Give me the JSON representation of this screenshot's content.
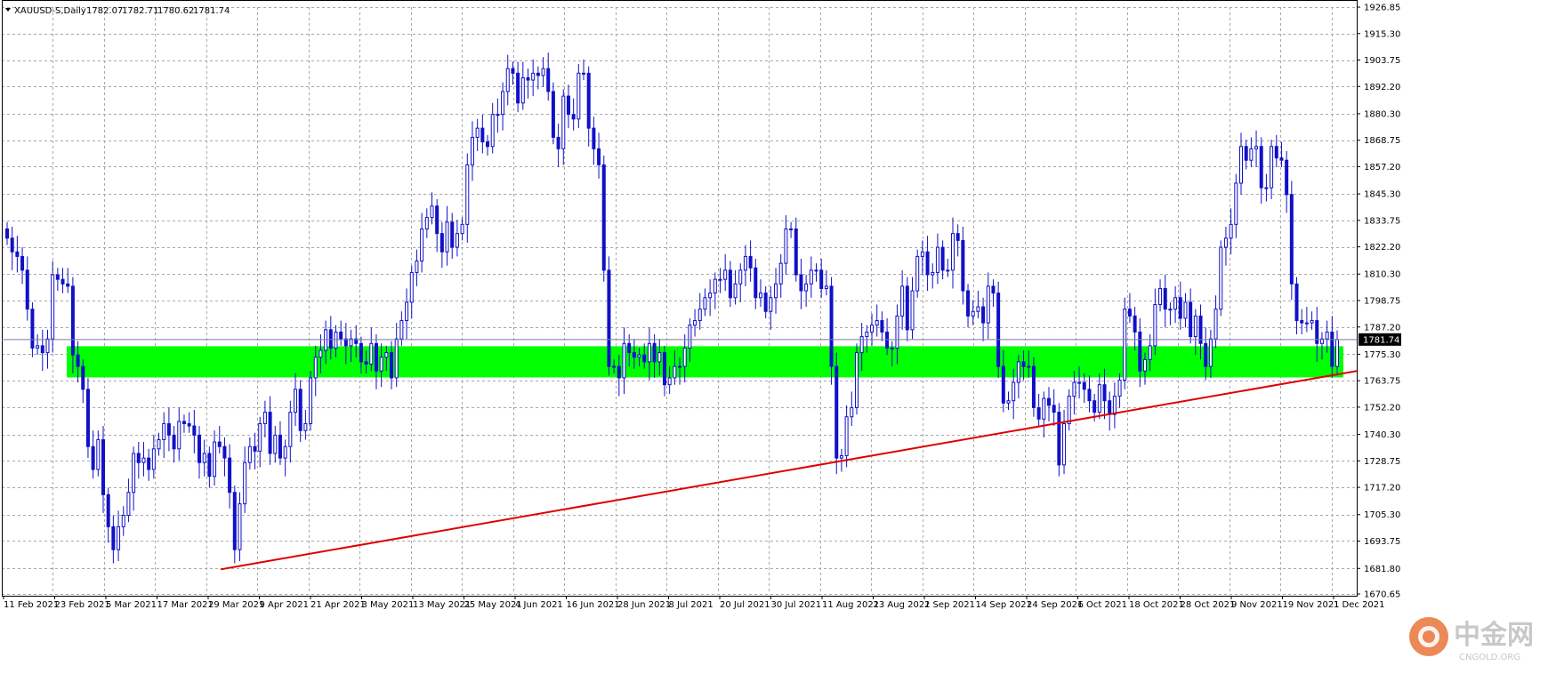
{
  "header": {
    "symbol": "XAUUSD-S,Daily",
    "values": [
      "1782.07",
      "1782.71",
      "1780.62",
      "1781.74"
    ]
  },
  "current_price_label": "1781.74",
  "watermark": {
    "cn": "中金网",
    "en": "CNGOLD.ORG"
  },
  "colors": {
    "candle": "#1010c8",
    "zone": "#00ff00",
    "trendline": "#e00000",
    "grid": "#a8a8a8",
    "price_tag_bg": "#000000"
  },
  "chart_data": {
    "type": "candlestick",
    "title": "",
    "ylim": [
      1670.65,
      1926.85
    ],
    "y_ticks": [
      "1926.85",
      "1915.30",
      "1903.75",
      "1892.20",
      "1880.30",
      "1868.75",
      "1857.20",
      "1845.30",
      "1833.75",
      "1822.20",
      "1810.30",
      "1798.75",
      "1787.20",
      "1775.30",
      "1763.75",
      "1752.20",
      "1740.30",
      "1728.75",
      "1717.20",
      "1705.30",
      "1693.75",
      "1681.80",
      "1670.65"
    ],
    "x_ticks": [
      "11 Feb 2021",
      "23 Feb 2021",
      "5 Mar 2021",
      "17 Mar 2021",
      "29 Mar 2021",
      "9 Apr 2021",
      "21 Apr 2021",
      "3 May 2021",
      "13 May 2021",
      "25 May 2021",
      "4 Jun 2021",
      "16 Jun 2021",
      "28 Jun 2021",
      "8 Jul 2021",
      "20 Jul 2021",
      "30 Jul 2021",
      "11 Aug 2021",
      "23 Aug 2021",
      "2 Sep 2021",
      "14 Sep 2021",
      "24 Sep 2021",
      "6 Oct 2021",
      "18 Oct 2021",
      "28 Oct 2021",
      "9 Nov 2021",
      "19 Nov 2021",
      "1 Dec 2021"
    ],
    "closes": [
      1826,
      1820,
      1818,
      1812,
      1795,
      1778,
      1779,
      1776,
      1782,
      1810,
      1808,
      1806,
      1805,
      1775,
      1770,
      1760,
      1735,
      1725,
      1738,
      1714,
      1700,
      1690,
      1700,
      1705,
      1715,
      1732,
      1728,
      1730,
      1725,
      1734,
      1738,
      1745,
      1740,
      1734,
      1746,
      1745,
      1744,
      1740,
      1728,
      1732,
      1722,
      1737,
      1735,
      1730,
      1715,
      1690,
      1710,
      1728,
      1735,
      1733,
      1745,
      1750,
      1732,
      1740,
      1730,
      1735,
      1750,
      1760,
      1742,
      1745,
      1765,
      1774,
      1777,
      1786,
      1778,
      1785,
      1782,
      1779,
      1782,
      1780,
      1772,
      1771,
      1780,
      1768,
      1774,
      1776,
      1765,
      1782,
      1790,
      1798,
      1811,
      1816,
      1830,
      1835,
      1840,
      1828,
      1820,
      1833,
      1822,
      1828,
      1832,
      1858,
      1870,
      1874,
      1868,
      1866,
      1880,
      1880,
      1890,
      1900,
      1898,
      1885,
      1896,
      1895,
      1898,
      1897,
      1900,
      1890,
      1870,
      1865,
      1888,
      1880,
      1878,
      1898,
      1898,
      1874,
      1865,
      1858,
      1812,
      1770,
      1770,
      1765,
      1780,
      1776,
      1774,
      1775,
      1772,
      1780,
      1772,
      1776,
      1762,
      1765,
      1770,
      1770,
      1778,
      1788,
      1790,
      1795,
      1800,
      1802,
      1808,
      1808,
      1812,
      1800,
      1806,
      1812,
      1818,
      1813,
      1800,
      1802,
      1794,
      1800,
      1806,
      1815,
      1830,
      1830,
      1810,
      1803,
      1806,
      1812,
      1812,
      1804,
      1805,
      1770,
      1730,
      1731,
      1748,
      1752,
      1776,
      1783,
      1785,
      1788,
      1790,
      1785,
      1778,
      1778,
      1792,
      1805,
      1786,
      1803,
      1818,
      1820,
      1810,
      1811,
      1822,
      1812,
      1812,
      1828,
      1825,
      1803,
      1792,
      1794,
      1796,
      1789,
      1805,
      1802,
      1770,
      1754,
      1755,
      1763,
      1772,
      1770,
      1770,
      1752,
      1747,
      1756,
      1753,
      1750,
      1727,
      1745,
      1757,
      1763,
      1763,
      1760,
      1755,
      1750,
      1762,
      1755,
      1749,
      1757,
      1764,
      1795,
      1792,
      1785,
      1768,
      1773,
      1779,
      1797,
      1804,
      1795,
      1795,
      1800,
      1791,
      1798,
      1783,
      1792,
      1780,
      1770,
      1782,
      1795,
      1822,
      1826,
      1832,
      1850,
      1866,
      1860,
      1865,
      1866,
      1848,
      1848,
      1866,
      1861,
      1860,
      1845,
      1806,
      1790,
      1789,
      1789,
      1790,
      1780,
      1782,
      1785,
      1770,
      1781.74
    ]
  }
}
